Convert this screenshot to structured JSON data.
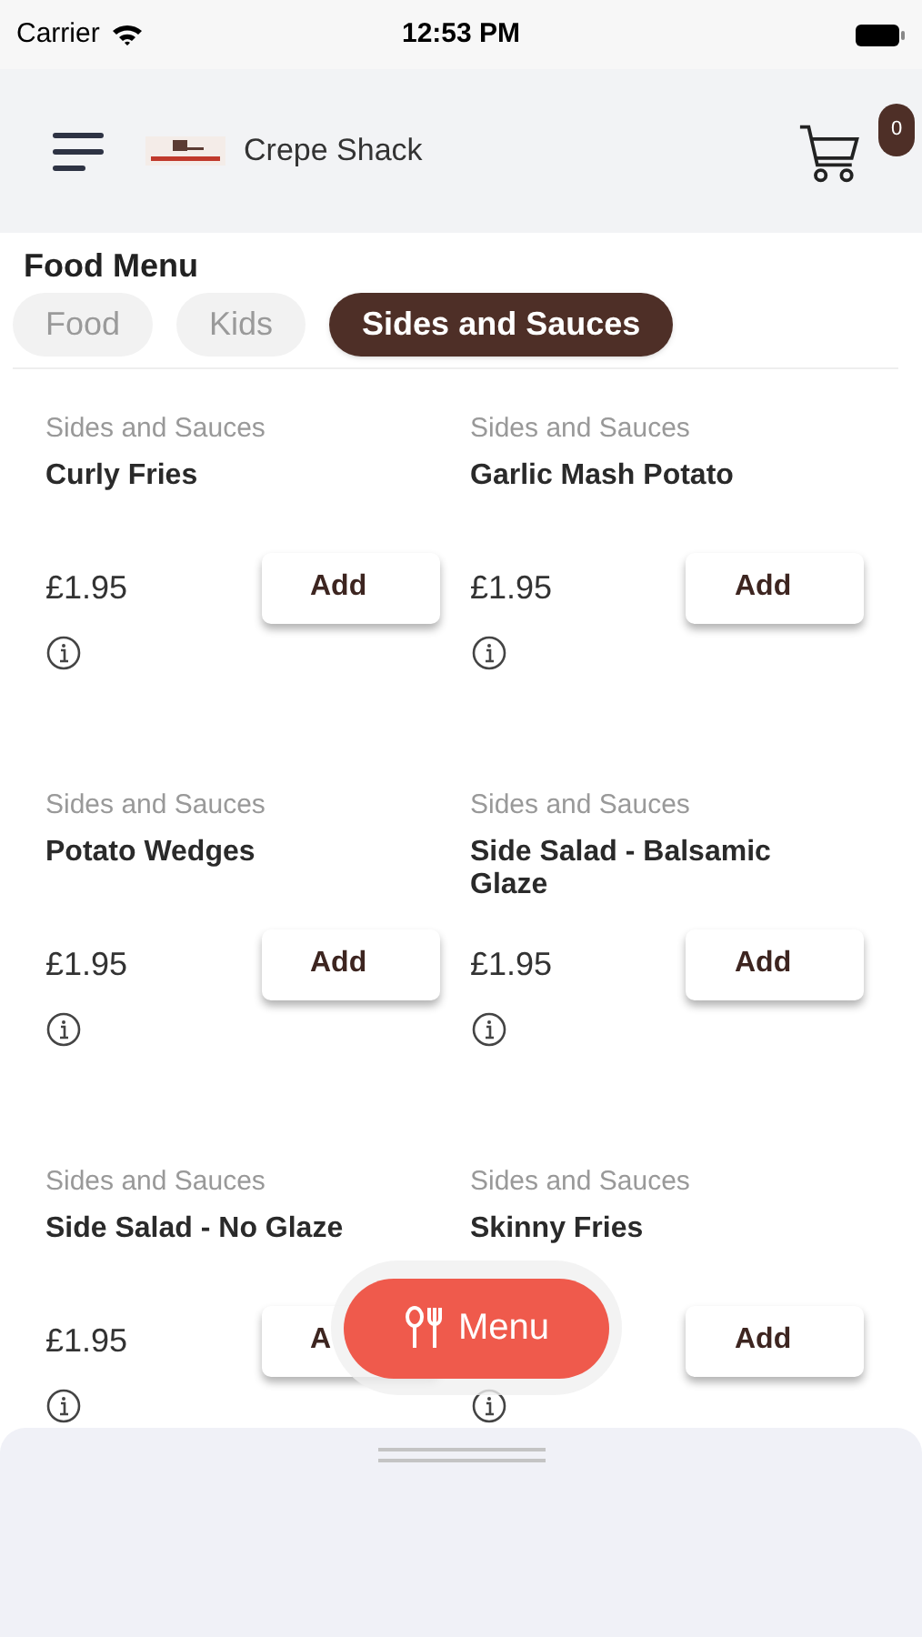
{
  "status_bar": {
    "carrier": "Carrier",
    "time": "12:53 PM"
  },
  "header": {
    "brand": "Crepe Shack",
    "cart_count": "0"
  },
  "title": "Food Menu",
  "tabs": [
    {
      "label": "Food",
      "selected": false
    },
    {
      "label": "Kids",
      "selected": false
    },
    {
      "label": "Sides and Sauces",
      "selected": true
    }
  ],
  "items": [
    {
      "category": "Sides and Sauces",
      "name": "Curly Fries",
      "price": "£1.95",
      "button": "Add"
    },
    {
      "category": "Sides and Sauces",
      "name": "Garlic Mash Potato",
      "price": "£1.95",
      "button": "Add"
    },
    {
      "category": "Sides and Sauces",
      "name": "Potato Wedges",
      "price": "£1.95",
      "button": "Add"
    },
    {
      "category": "Sides and Sauces",
      "name": "Side Salad - Balsamic Glaze",
      "price": "£1.95",
      "button": "Add"
    },
    {
      "category": "Sides and Sauces",
      "name": "Side Salad - No Glaze",
      "price": "£1.95",
      "button": "A"
    },
    {
      "category": "Sides and Sauces",
      "name": "Skinny Fries",
      "button": "Add"
    }
  ],
  "fab": {
    "label": "Menu"
  }
}
